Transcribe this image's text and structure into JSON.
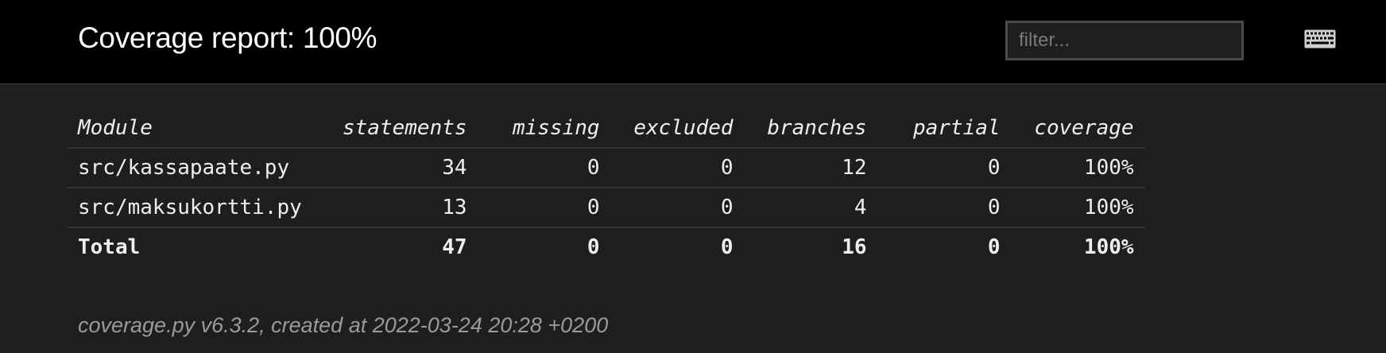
{
  "header": {
    "title": "Coverage report: 100%",
    "filter_placeholder": "filter...",
    "keyboard_icon": "keyboard-icon"
  },
  "table": {
    "columns": [
      "Module",
      "statements",
      "missing",
      "excluded",
      "branches",
      "partial",
      "coverage"
    ],
    "rows": [
      {
        "module": "src/kassapaate.py",
        "statements": "34",
        "missing": "0",
        "excluded": "0",
        "branches": "12",
        "partial": "0",
        "coverage": "100%"
      },
      {
        "module": "src/maksukortti.py",
        "statements": "13",
        "missing": "0",
        "excluded": "0",
        "branches": "4",
        "partial": "0",
        "coverage": "100%"
      }
    ],
    "total": {
      "module": "Total",
      "statements": "47",
      "missing": "0",
      "excluded": "0",
      "branches": "16",
      "partial": "0",
      "coverage": "100%"
    }
  },
  "footer": {
    "text": "coverage.py v6.3.2, created at 2022-03-24 20:28 +0200"
  },
  "colors": {
    "header_bg": "#000000",
    "page_bg": "#1e1e1e",
    "text": "#eeeeee",
    "muted": "#9a9a9a"
  }
}
